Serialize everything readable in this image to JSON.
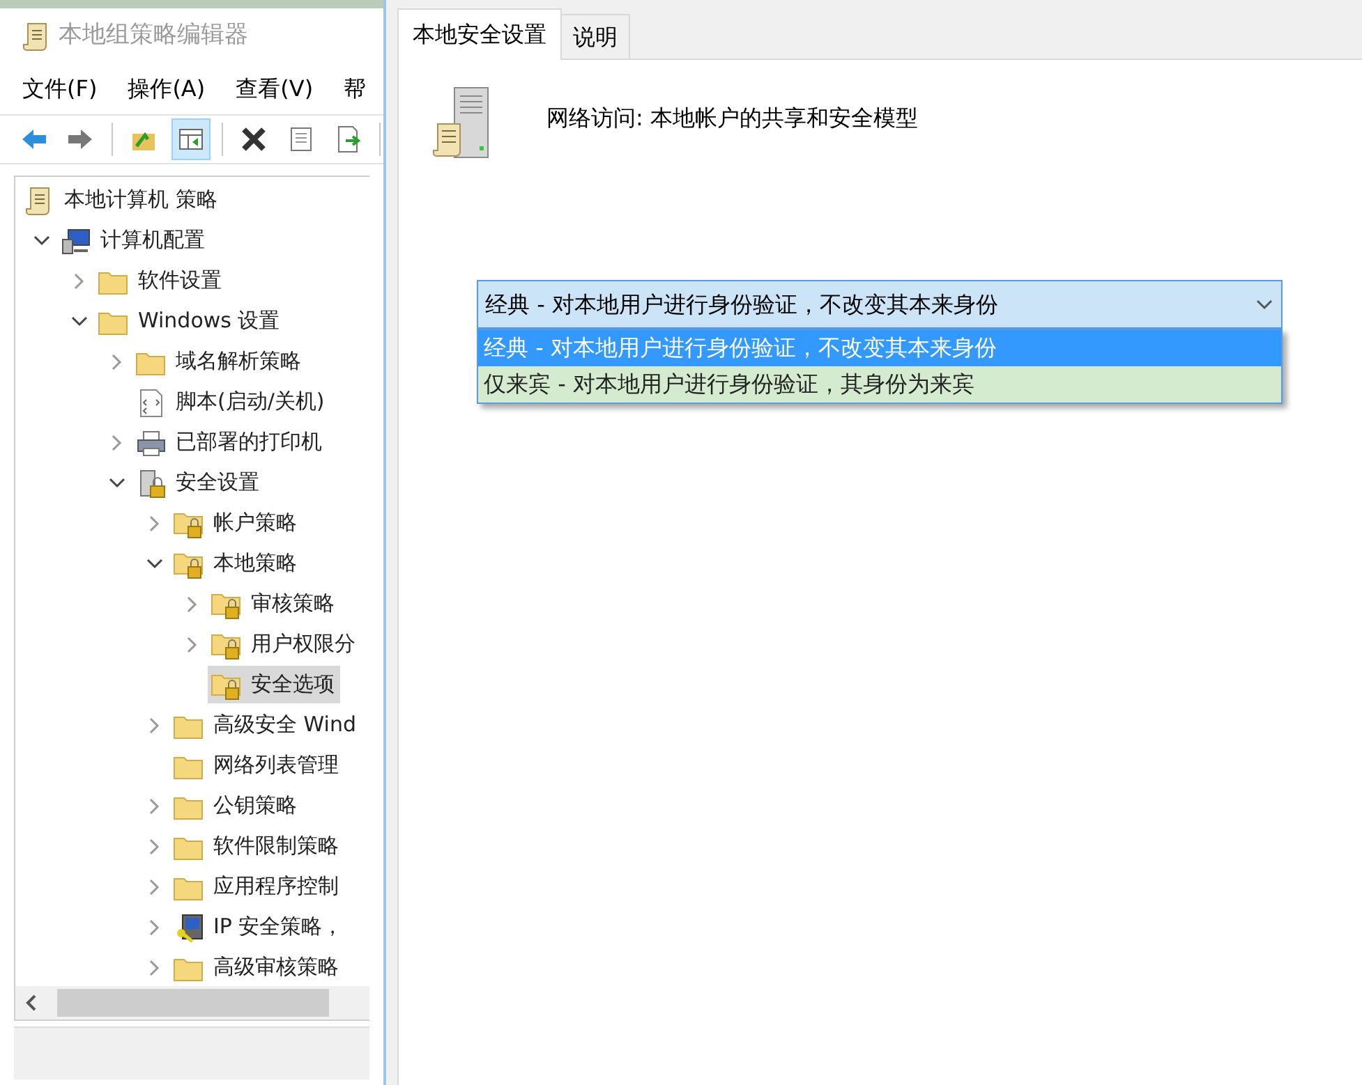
{
  "window": {
    "title": "本地组策略编辑器"
  },
  "menu": [
    "文件(F)",
    "操作(A)",
    "查看(V)",
    "帮"
  ],
  "toolbar": [
    {
      "kind": "back",
      "active": false
    },
    {
      "kind": "forward",
      "active": false
    },
    {
      "kind": "sep"
    },
    {
      "kind": "up",
      "active": false
    },
    {
      "kind": "tree",
      "active": true
    },
    {
      "kind": "sep"
    },
    {
      "kind": "delete",
      "active": false
    },
    {
      "kind": "properties",
      "active": false
    },
    {
      "kind": "export",
      "active": false
    },
    {
      "kind": "sep"
    }
  ],
  "tree": [
    {
      "label": "本地计算机 策略",
      "kind": "scroll",
      "selected": false,
      "children": [
        {
          "label": "计算机配置",
          "kind": "computer",
          "expanded": true,
          "selected": false,
          "children": [
            {
              "label": "软件设置",
              "kind": "folder",
              "expanded": false,
              "selected": false
            },
            {
              "label": "Windows 设置",
              "kind": "folder",
              "expanded": true,
              "selected": false,
              "children": [
                {
                  "label": "域名解析策略",
                  "kind": "folder",
                  "expanded": false,
                  "selected": false
                },
                {
                  "label": "脚本(启动/关机)",
                  "kind": "script",
                  "selected": false
                },
                {
                  "label": "已部署的打印机",
                  "kind": "printer",
                  "expanded": false,
                  "selected": false
                },
                {
                  "label": "安全设置",
                  "kind": "security",
                  "expanded": true,
                  "selected": false,
                  "children": [
                    {
                      "label": "帐户策略",
                      "kind": "lockfolder",
                      "expanded": false,
                      "selected": false
                    },
                    {
                      "label": "本地策略",
                      "kind": "lockfolder",
                      "expanded": true,
                      "selected": false,
                      "children": [
                        {
                          "label": "审核策略",
                          "kind": "lockfolder",
                          "expanded": false,
                          "selected": false
                        },
                        {
                          "label": "用户权限分",
                          "kind": "lockfolder",
                          "expanded": false,
                          "selected": false
                        },
                        {
                          "label": "安全选项",
                          "kind": "lockfolder",
                          "selected": true
                        }
                      ]
                    },
                    {
                      "label": "高级安全 Wind",
                      "kind": "folder",
                      "expanded": false,
                      "selected": false
                    },
                    {
                      "label": "网络列表管理",
                      "kind": "folder",
                      "selected": false
                    },
                    {
                      "label": "公钥策略",
                      "kind": "folder",
                      "expanded": false,
                      "selected": false
                    },
                    {
                      "label": "软件限制策略",
                      "kind": "folder",
                      "expanded": false,
                      "selected": false
                    },
                    {
                      "label": "应用程序控制",
                      "kind": "folder",
                      "expanded": false,
                      "selected": false
                    },
                    {
                      "label": "IP 安全策略，",
                      "kind": "ipsec",
                      "expanded": false,
                      "selected": false
                    },
                    {
                      "label": "高级审核策略",
                      "kind": "folder",
                      "expanded": false,
                      "selected": false
                    }
                  ]
                }
              ]
            }
          ]
        }
      ]
    }
  ],
  "dialog": {
    "tabs": [
      {
        "label": "本地安全设置",
        "selected": true
      },
      {
        "label": "说明",
        "selected": false
      }
    ],
    "policy_title": "网络访问: 本地帐户的共享和安全模型",
    "combobox": {
      "value": "经典 - 对本地用户进行身份验证，不改变其本来身份",
      "expanded": true,
      "options": [
        {
          "label": "经典 - 对本地用户进行身份验证，不改变其本来身份",
          "selected": true,
          "hovered": false
        },
        {
          "label": "仅来宾 - 对本地用户进行身份验证，其身份为来宾",
          "selected": false,
          "hovered": true
        }
      ]
    }
  }
}
